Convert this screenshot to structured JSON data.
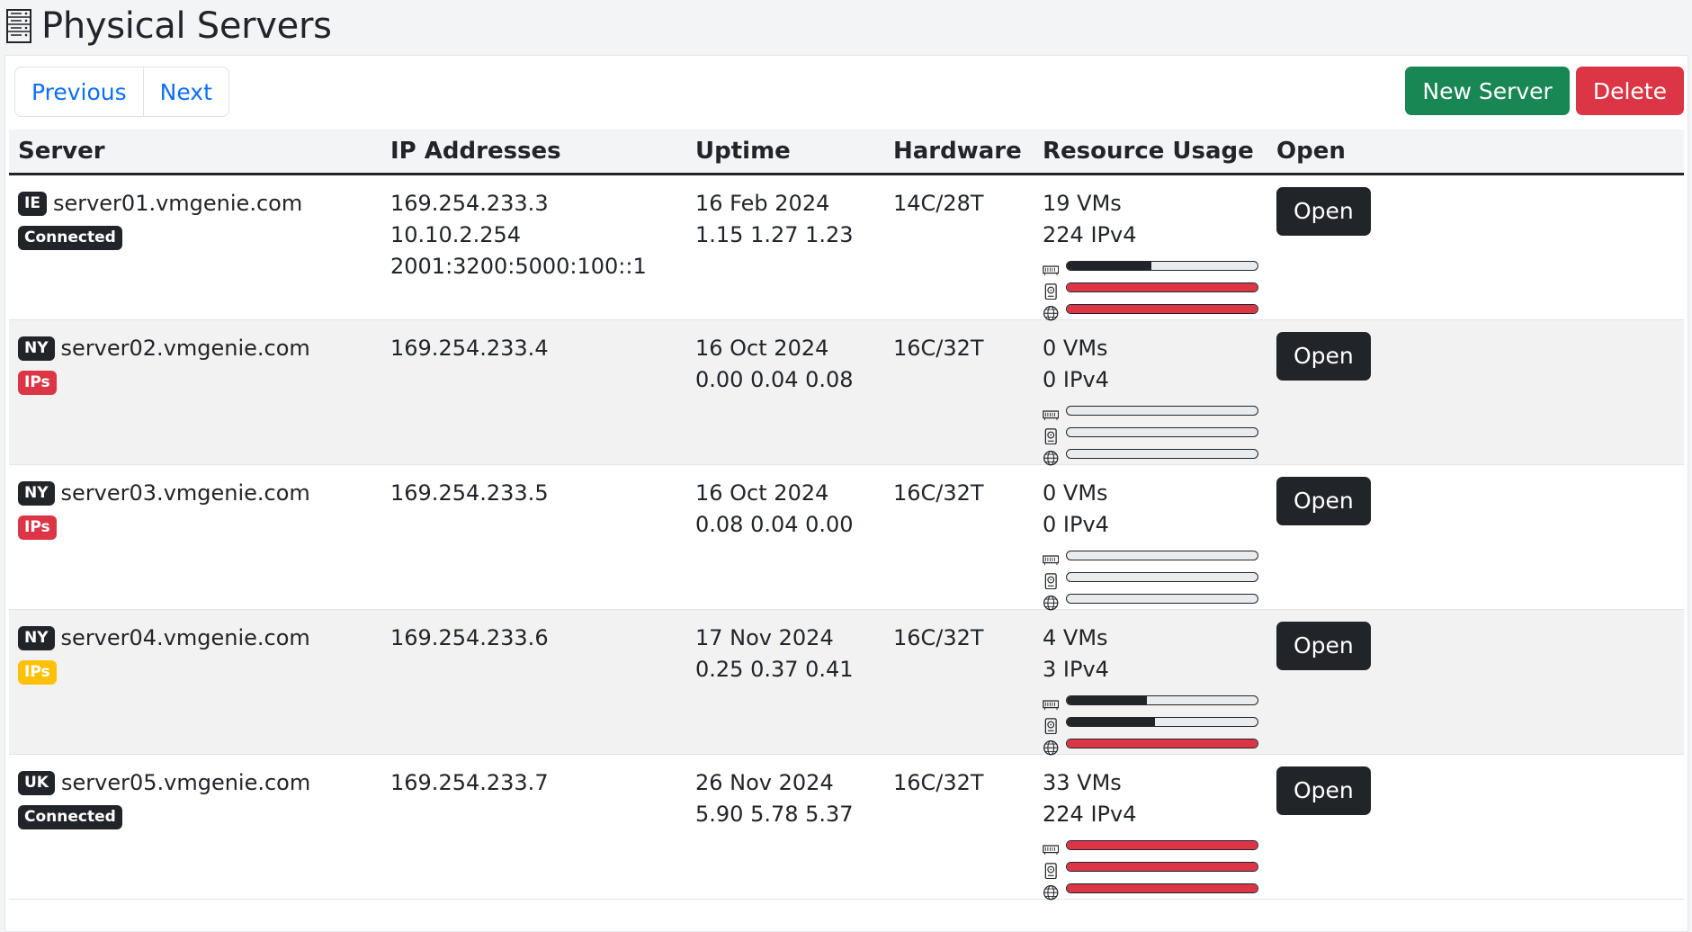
{
  "page": {
    "title": "Physical Servers",
    "icon": "server-rack-icon"
  },
  "toolbar": {
    "previous_label": "Previous",
    "next_label": "Next",
    "new_server_label": "New Server",
    "delete_label": "Delete"
  },
  "colors": {
    "green": "#198754",
    "red": "#dc3545",
    "yellow": "#ffc107",
    "dark": "#212529",
    "link": "#0d6efd"
  },
  "table": {
    "headers": [
      "Server",
      "IP Addresses",
      "Uptime",
      "Hardware",
      "Resource Usage",
      "Open"
    ],
    "rows": [
      {
        "location": "IE",
        "name": "server01.vmgenie.com",
        "status": "Connected",
        "status_color": "dark",
        "ips": [
          "169.254.233.3",
          "10.10.2.254",
          "2001:3200:5000:100::1"
        ],
        "uptime_date": "16 Feb 2024",
        "load": "1.15 1.27 1.23",
        "hardware": "14C/28T",
        "vms": "19 VMs",
        "ipv4": "224 IPv4",
        "bars": [
          {
            "icon": "memory-icon",
            "value": 0.44,
            "color": "dark"
          },
          {
            "icon": "disk-icon",
            "value": 1.0,
            "color": "red"
          },
          {
            "icon": "globe-icon",
            "value": 1.0,
            "color": "red"
          }
        ],
        "open_label": "Open"
      },
      {
        "location": "NY",
        "name": "server02.vmgenie.com",
        "status": "IPs",
        "status_color": "red",
        "ips": [
          "169.254.233.4"
        ],
        "uptime_date": "16 Oct 2024",
        "load": "0.00 0.04 0.08",
        "hardware": "16C/32T",
        "vms": "0 VMs",
        "ipv4": "0 IPv4",
        "bars": [
          {
            "icon": "memory-icon",
            "value": 0.0,
            "color": "dark"
          },
          {
            "icon": "disk-icon",
            "value": 0.0,
            "color": "dark"
          },
          {
            "icon": "globe-icon",
            "value": 0.0,
            "color": "dark"
          }
        ],
        "open_label": "Open"
      },
      {
        "location": "NY",
        "name": "server03.vmgenie.com",
        "status": "IPs",
        "status_color": "red",
        "ips": [
          "169.254.233.5"
        ],
        "uptime_date": "16 Oct 2024",
        "load": "0.08 0.04 0.00",
        "hardware": "16C/32T",
        "vms": "0 VMs",
        "ipv4": "0 IPv4",
        "bars": [
          {
            "icon": "memory-icon",
            "value": 0.0,
            "color": "dark"
          },
          {
            "icon": "disk-icon",
            "value": 0.0,
            "color": "dark"
          },
          {
            "icon": "globe-icon",
            "value": 0.0,
            "color": "dark"
          }
        ],
        "open_label": "Open"
      },
      {
        "location": "NY",
        "name": "server04.vmgenie.com",
        "status": "IPs",
        "status_color": "yellow",
        "ips": [
          "169.254.233.6"
        ],
        "uptime_date": "17 Nov 2024",
        "load": "0.25 0.37 0.41",
        "hardware": "16C/32T",
        "vms": "4 VMs",
        "ipv4": "3 IPv4",
        "bars": [
          {
            "icon": "memory-icon",
            "value": 0.42,
            "color": "dark"
          },
          {
            "icon": "disk-icon",
            "value": 0.46,
            "color": "dark"
          },
          {
            "icon": "globe-icon",
            "value": 1.0,
            "color": "red"
          }
        ],
        "open_label": "Open"
      },
      {
        "location": "UK",
        "name": "server05.vmgenie.com",
        "status": "Connected",
        "status_color": "dark",
        "ips": [
          "169.254.233.7"
        ],
        "uptime_date": "26 Nov 2024",
        "load": "5.90 5.78 5.37",
        "hardware": "16C/32T",
        "vms": "33 VMs",
        "ipv4": "224 IPv4",
        "bars": [
          {
            "icon": "memory-icon",
            "value": 1.0,
            "color": "red"
          },
          {
            "icon": "disk-icon",
            "value": 1.0,
            "color": "red"
          },
          {
            "icon": "globe-icon",
            "value": 1.0,
            "color": "red"
          }
        ],
        "open_label": "Open"
      }
    ]
  }
}
